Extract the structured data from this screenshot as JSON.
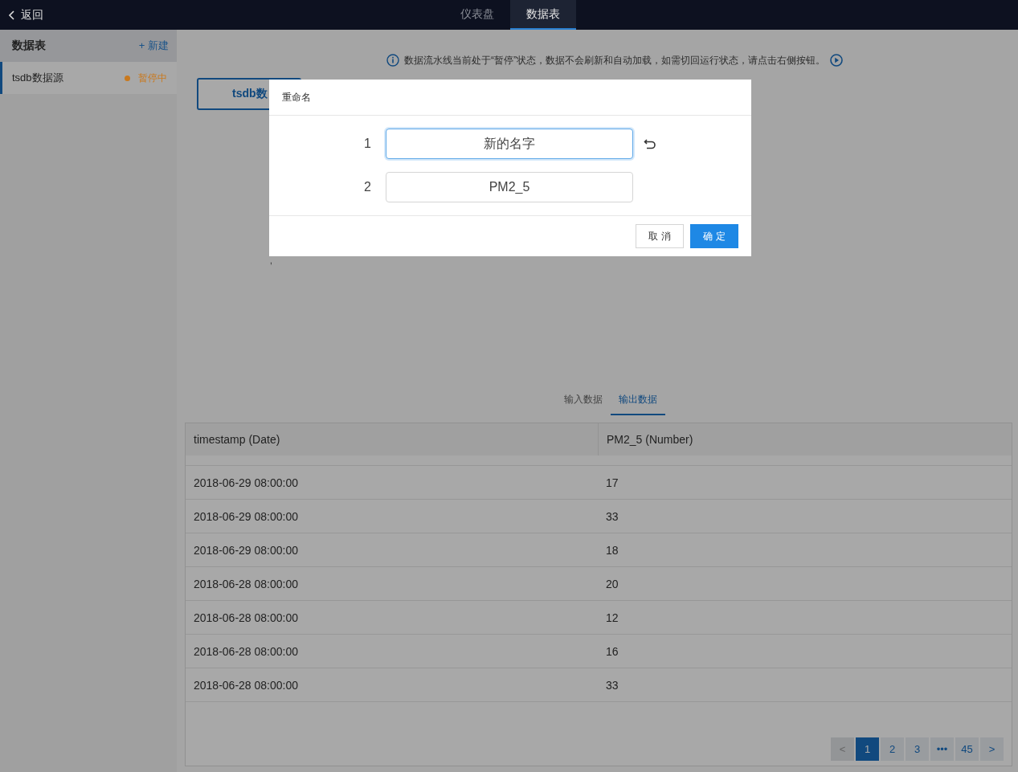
{
  "topbar": {
    "back": "返回",
    "tabs": [
      {
        "label": "仪表盘",
        "selected": false
      },
      {
        "label": "数据表",
        "selected": true
      }
    ]
  },
  "sidebar": {
    "title": "数据表",
    "new_button": "+ 新建",
    "items": [
      {
        "name": "tsdb数据源",
        "status": "暂停中",
        "selected": true,
        "color": "#c9791e"
      }
    ]
  },
  "notice": {
    "text": "数据流水线当前处于“暂停”状态，数据不会刷新和自动加载，如需切回运行状态，请点击右侧按钮。"
  },
  "source_button": "tsdb数",
  "stray_mark": ",",
  "data_tabs": [
    {
      "label": "输入数据",
      "selected": false
    },
    {
      "label": "输出数据",
      "selected": true
    }
  ],
  "table": {
    "columns": [
      "timestamp (Date)",
      "PM2_5 (Number)"
    ],
    "rows": [
      [
        "2018-06-29 08:00:00",
        "17"
      ],
      [
        "2018-06-29 08:00:00",
        "33"
      ],
      [
        "2018-06-29 08:00:00",
        "18"
      ],
      [
        "2018-06-28 08:00:00",
        "20"
      ],
      [
        "2018-06-28 08:00:00",
        "12"
      ],
      [
        "2018-06-28 08:00:00",
        "16"
      ],
      [
        "2018-06-28 08:00:00",
        "33"
      ]
    ]
  },
  "pagination": {
    "prev": "<",
    "next": ">",
    "disabled_prev": true,
    "pages": [
      {
        "label": "1",
        "selected": true
      },
      {
        "label": "2",
        "selected": false
      },
      {
        "label": "3",
        "selected": false
      },
      {
        "label": "•••",
        "selected": false
      },
      {
        "label": "45",
        "selected": false
      }
    ]
  },
  "dialog": {
    "title": "重命名",
    "fields": [
      {
        "index": "1",
        "value": "新的名字",
        "focused": true,
        "undo": true
      },
      {
        "index": "2",
        "value": "PM2_5",
        "focused": false,
        "undo": false
      }
    ],
    "cancel": "取 消",
    "ok": "确 定"
  }
}
